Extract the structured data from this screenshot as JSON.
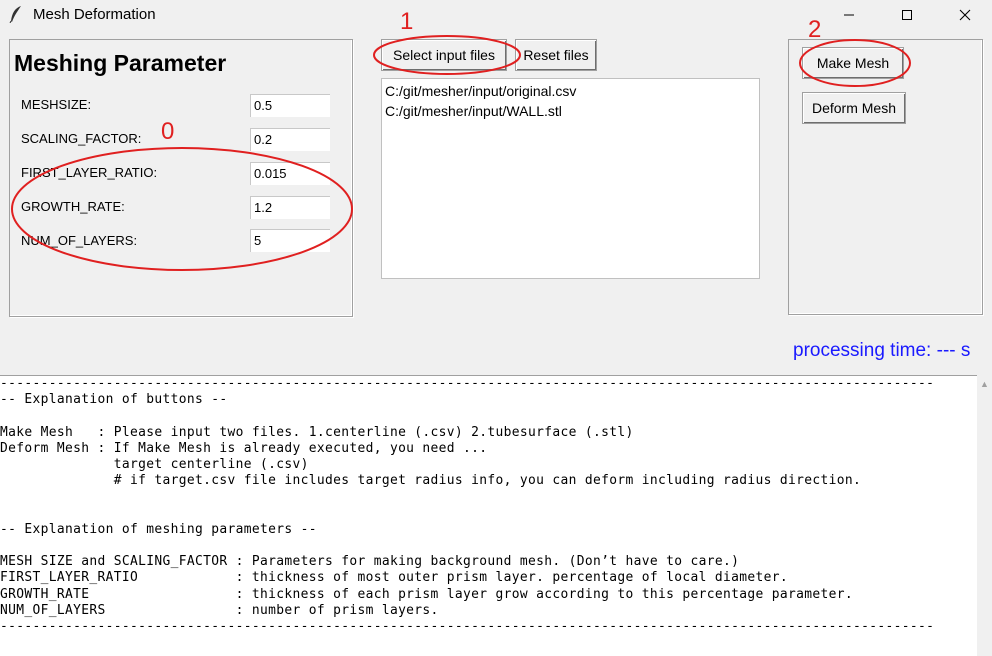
{
  "window": {
    "title": "Mesh Deformation",
    "minimize": "—",
    "maximize": "☐",
    "close": "✕"
  },
  "params": {
    "heading": "Meshing Parameter",
    "rows": [
      {
        "label": "MESHSIZE:",
        "value": "0.5"
      },
      {
        "label": "SCALING_FACTOR:",
        "value": "0.2"
      },
      {
        "label": "FIRST_LAYER_RATIO:",
        "value": "0.015"
      },
      {
        "label": "GROWTH_RATE:",
        "value": "1.2"
      },
      {
        "label": "NUM_OF_LAYERS:",
        "value": "5"
      }
    ]
  },
  "files": {
    "select_label": "Select input files",
    "reset_label": "Reset files",
    "items": [
      "C:/git/mesher/input/original.csv",
      "C:/git/mesher/input/WALL.stl"
    ]
  },
  "actions": {
    "make_label": "Make Mesh",
    "deform_label": "Deform Mesh"
  },
  "status": {
    "processing_time": "processing time: --- s"
  },
  "explanation": "-------------------------------------------------------------------------------------------------------------------\n-- Explanation of buttons --\n\nMake Mesh   : Please input two files. 1.centerline (.csv) 2.tubesurface (.stl)\nDeform Mesh : If Make Mesh is already executed, you need ...\n              target centerline (.csv)\n              # if target.csv file includes target radius info, you can deform including radius direction.\n\n\n-- Explanation of meshing parameters --\n\nMESH SIZE and SCALING_FACTOR : Parameters for making background mesh. (Don’t have to care.)\nFIRST_LAYER_RATIO            : thickness of most outer prism layer. percentage of local diameter.\nGROWTH_RATE                  : thickness of each prism layer grow according to this percentage parameter.\nNUM_OF_LAYERS                : number of prism layers.\n-------------------------------------------------------------------------------------------------------------------",
  "annotations": {
    "zero": "0",
    "one": "1",
    "two": "2",
    "color": "#e02020"
  },
  "colors": {
    "accent": "#1a1aff",
    "background": "#f0f0f0"
  }
}
